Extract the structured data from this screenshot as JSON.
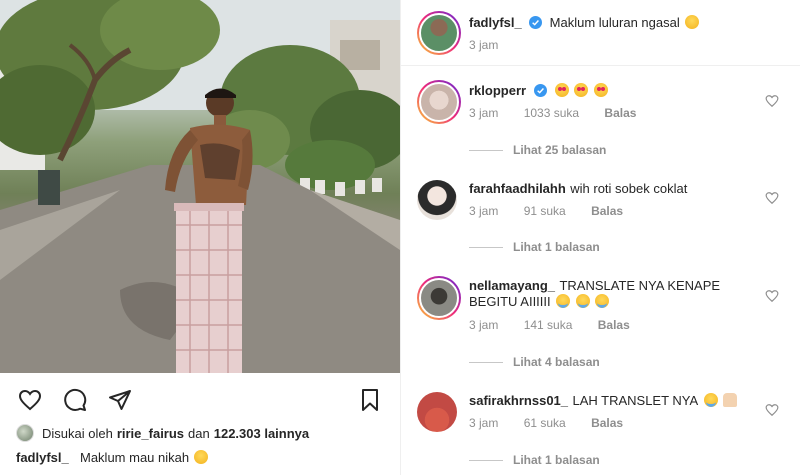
{
  "post": {
    "liked_by_prefix": "Disukai oleh",
    "liked_by_user": "ririe_fairus",
    "liked_by_and": "dan",
    "liked_by_count": "122.303 lainnya",
    "caption_user": "fadlyfsl_",
    "caption_text": "Maklum mau nikah"
  },
  "original": {
    "username": "fadlyfsl_",
    "text": "Maklum luluran ngasal",
    "time": "3 jam"
  },
  "comments": [
    {
      "username": "rklopperr",
      "verified": true,
      "text": "",
      "time": "3 jam",
      "likes": "1033 suka",
      "reply": "Balas",
      "view_replies": "Lihat 25 balasan"
    },
    {
      "username": "farahfaadhilahh",
      "text": "wih roti sobek coklat",
      "time": "3 jam",
      "likes": "91 suka",
      "reply": "Balas",
      "view_replies": "Lihat 1 balasan"
    },
    {
      "username": "nellamayang_",
      "text": "TRANSLATE NYA KENAPE",
      "text2": "BEGITU AIIIIII",
      "time": "3 jam",
      "likes": "141 suka",
      "reply": "Balas",
      "view_replies": "Lihat 4 balasan"
    },
    {
      "username": "safirakhrnss01_",
      "text": "LAH TRANSLET NYA",
      "time": "3 jam",
      "likes": "61 suka",
      "reply": "Balas",
      "view_replies": "Lihat 1 balasan"
    }
  ],
  "icons": {
    "like": "heart-icon",
    "comment": "comment-icon",
    "share": "send-icon",
    "save": "bookmark-icon",
    "verified": "verified-badge-icon"
  },
  "colors": {
    "text": "#262626",
    "muted": "#8e8e8e",
    "verified": "#3897f0",
    "divider": "#efefef"
  }
}
